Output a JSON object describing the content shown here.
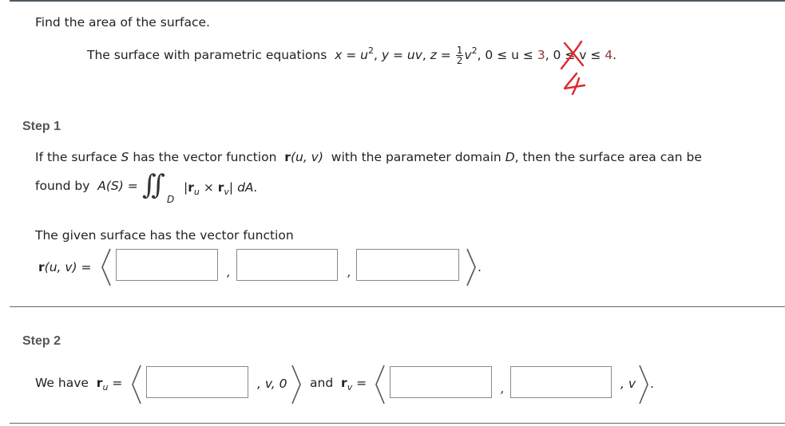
{
  "problem": {
    "prompt": "Find the area of the surface.",
    "surface_intro": "The surface with parametric equations",
    "equations": {
      "x": "x = u",
      "x_exp": "2",
      "y": "y = uv",
      "z_prefix": "z =",
      "z_frac_num": "1",
      "z_frac_den": "2",
      "z_var": "v",
      "z_exp": "2",
      "u_range_prefix": "0 ≤ u ≤",
      "u_upper_crossed": "3",
      "v_range_prefix": "0 ≤ v ≤",
      "v_upper": "4",
      "period": "."
    },
    "annotation": {
      "handwritten_value": "4",
      "color": "#e0262b"
    }
  },
  "step1": {
    "label": "Step 1",
    "line1_a": "If the surface",
    "line1_S": "S",
    "line1_b": "has the vector function",
    "line1_r": "r",
    "line1_args": "(u, v)",
    "line1_c": "with the parameter domain",
    "line1_D": "D",
    "line1_d": ", then the surface area can be",
    "line2_a": "found by",
    "line2_AS": "A(S) =",
    "integral_symbol": "∬",
    "integral_domain": "D",
    "integrand_open": "|",
    "integrand_r1": "r",
    "integrand_sub1": "u",
    "integrand_times": "×",
    "integrand_r2": "r",
    "integrand_sub2": "v",
    "integrand_close": "|",
    "integrand_dA": "dA.",
    "given_text": "The given surface has the vector function",
    "r_label_r": "r",
    "r_label_args": "(u, v) =",
    "inputs": [
      {
        "name": "r-component-1",
        "value": "",
        "placeholder": ""
      },
      {
        "name": "r-component-2",
        "value": "",
        "placeholder": ""
      },
      {
        "name": "r-component-3",
        "value": "",
        "placeholder": ""
      }
    ],
    "comma": ",",
    "period": "."
  },
  "step2": {
    "label": "Step 2",
    "we_have": "We have",
    "ru_r": "r",
    "ru_sub": "u",
    "eq": "=",
    "ru_fixed": ", v, 0",
    "and": "and",
    "rv_r": "r",
    "rv_sub": "v",
    "rv_fixed": ", v",
    "comma": ",",
    "period": ".",
    "inputs": [
      {
        "name": "ru-component-1",
        "value": "",
        "placeholder": ""
      },
      {
        "name": "rv-component-1",
        "value": "",
        "placeholder": ""
      },
      {
        "name": "rv-component-2",
        "value": "",
        "placeholder": ""
      }
    ]
  }
}
